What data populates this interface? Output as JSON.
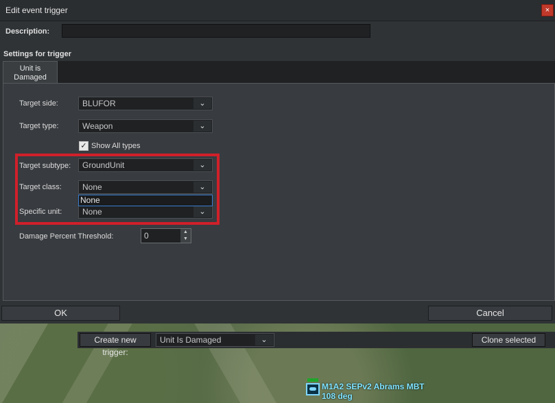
{
  "window": {
    "title": "Edit event trigger",
    "close_label": "×"
  },
  "description": {
    "label": "Description:",
    "value": ""
  },
  "settings": {
    "label": "Settings for trigger"
  },
  "tabs": [
    {
      "label": "Unit is Damaged"
    }
  ],
  "form": {
    "target_side": {
      "label": "Target side:",
      "value": "BLUFOR"
    },
    "target_type": {
      "label": "Target type:",
      "value": "Weapon"
    },
    "show_all_types": {
      "label": "Show All types",
      "checked": true
    },
    "target_subtype": {
      "label": "Target subtype:",
      "value": "GroundUnit"
    },
    "target_class": {
      "label": "Target class:",
      "value": "None",
      "open_options": [
        "None"
      ]
    },
    "specific_unit": {
      "label": "Specific unit:",
      "value": "None"
    },
    "damage_threshold": {
      "label": "Damage Percent Threshold:",
      "value": "0"
    }
  },
  "buttons": {
    "ok": "OK",
    "cancel": "Cancel"
  },
  "lower_toolbar": {
    "create_label": "Create new trigger:",
    "create_value": "Unit Is Damaged",
    "clone_label": "Clone selected"
  },
  "map_unit": {
    "name": "M1A2 SEPv2 Abrams MBT",
    "heading": "108 deg"
  },
  "colors": {
    "accent_red": "#d0202a",
    "unit_cyan": "#7fe3ff",
    "focus_blue": "#3a7ed0"
  }
}
